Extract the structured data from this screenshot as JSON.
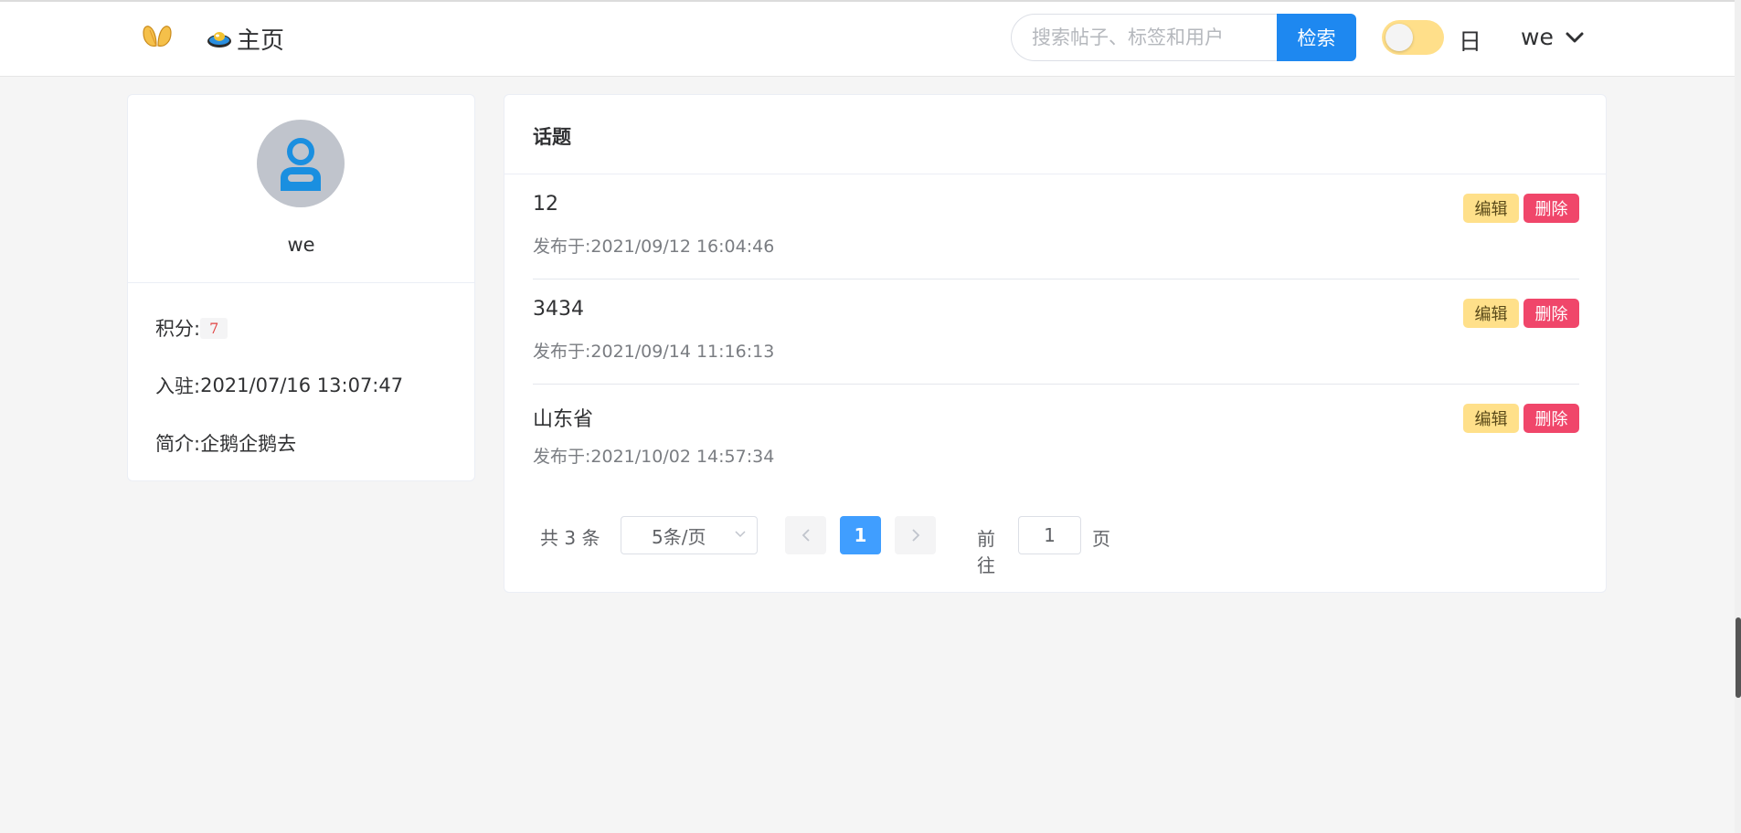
{
  "header": {
    "home_label": "主页",
    "search": {
      "placeholder": "搜索帖子、标签和用户",
      "button_label": "检索"
    },
    "theme": {
      "label": "日"
    },
    "user": {
      "name": "we"
    }
  },
  "profile": {
    "name": "we",
    "score_label": "积分:",
    "score_value": "7",
    "joined_label": "入驻:",
    "joined_value": "2021/07/16 13:07:47",
    "bio_label": "简介:",
    "bio_value": "企鹅企鹅去"
  },
  "topics": {
    "title": "话题",
    "items": [
      {
        "title": "12",
        "date": "发布于:2021/09/12 16:04:46",
        "edit_label": "编辑",
        "delete_label": "删除"
      },
      {
        "title": "3434",
        "date": "发布于:2021/09/14 11:16:13",
        "edit_label": "编辑",
        "delete_label": "删除"
      },
      {
        "title": "山东省",
        "date": "发布于:2021/10/02 14:57:34",
        "edit_label": "编辑",
        "delete_label": "删除"
      }
    ]
  },
  "pagination": {
    "total_text": "共 3 条",
    "page_size": "5条/页",
    "current_page": "1",
    "goto_label": "前往",
    "goto_value": "1",
    "goto_suffix": "页"
  },
  "colors": {
    "primary": "#1e88f0",
    "page_active": "#409eff",
    "edit": "#ffe08a",
    "delete": "#f0466a",
    "toggle": "#ffdf8a"
  }
}
